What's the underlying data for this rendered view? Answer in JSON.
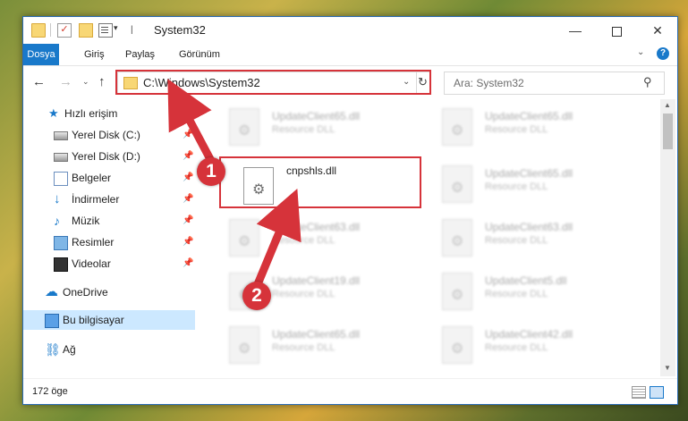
{
  "window": {
    "title": "System32",
    "controls": {
      "minimize": "—",
      "maximize": "",
      "close": "✕"
    }
  },
  "quick_access": {
    "dropdown": "▾",
    "separator": "|"
  },
  "ribbon": {
    "tabs": [
      "Dosya",
      "Giriş",
      "Paylaş",
      "Görünüm"
    ],
    "collapse_icon": "⌄",
    "help_icon": "?"
  },
  "navigation": {
    "back": "←",
    "forward": "→",
    "recent": "⌄",
    "up": "↑",
    "address": "C:\\Windows\\System32",
    "address_dropdown": "⌄",
    "refresh": "↻",
    "search_placeholder": "Ara: System32",
    "search_icon": "⚲"
  },
  "sidebar": {
    "items": [
      {
        "label": "Hızlı erişim",
        "icon": "star-icon",
        "glyph": "★",
        "pinned": false
      },
      {
        "label": "Yerel Disk (C:)",
        "icon": "disk-icon",
        "glyph": "",
        "pinned": true
      },
      {
        "label": "Yerel Disk (D:)",
        "icon": "disk-icon",
        "glyph": "",
        "pinned": true
      },
      {
        "label": "Belgeler",
        "icon": "document-icon",
        "glyph": "",
        "pinned": true
      },
      {
        "label": "İndirmeler",
        "icon": "download-icon",
        "glyph": "↓",
        "pinned": true
      },
      {
        "label": "Müzik",
        "icon": "music-icon",
        "glyph": "♪",
        "pinned": true
      },
      {
        "label": "Resimler",
        "icon": "picture-icon",
        "glyph": "",
        "pinned": true
      },
      {
        "label": "Videolar",
        "icon": "video-icon",
        "glyph": "",
        "pinned": true
      },
      {
        "label": "OneDrive",
        "icon": "cloud-icon",
        "glyph": "☁",
        "pinned": false
      },
      {
        "label": "Bu bilgisayar",
        "icon": "computer-icon",
        "glyph": "",
        "pinned": false,
        "selected": true
      },
      {
        "label": "Ağ",
        "icon": "network-icon",
        "glyph": "⛓",
        "pinned": false
      }
    ],
    "pin_glyph": "📌"
  },
  "files": [
    {
      "name": "UpdateClient65.dll",
      "type": "Resource DLL",
      "blurred": true
    },
    {
      "name": "UpdateClient65.dll",
      "type": "Resource DLL",
      "blurred": true
    },
    {
      "name": "cnpshls.dll",
      "type": "",
      "blurred": false
    },
    {
      "name": "UpdateClient65.dll",
      "type": "Resource DLL",
      "blurred": true
    },
    {
      "name": "UpdateClient63.dll",
      "type": "Resource DLL",
      "blurred": true
    },
    {
      "name": "UpdateClient63.dll",
      "type": "Resource DLL",
      "blurred": true
    },
    {
      "name": "UpdateClient19.dll",
      "type": "Resource DLL",
      "blurred": true
    },
    {
      "name": "UpdateClient5.dll",
      "type": "Resource DLL",
      "blurred": true
    },
    {
      "name": "UpdateClient65.dll",
      "type": "Resource DLL",
      "blurred": true
    },
    {
      "name": "UpdateClient42.dll",
      "type": "Resource DLL",
      "blurred": true
    }
  ],
  "status": {
    "item_count": "172 öge"
  },
  "annotations": {
    "badge1": "1",
    "badge2": "2",
    "color": "#d6333a"
  },
  "colors": {
    "accent": "#1979ca",
    "selection": "#cce8ff",
    "annotation": "#d6333a"
  }
}
